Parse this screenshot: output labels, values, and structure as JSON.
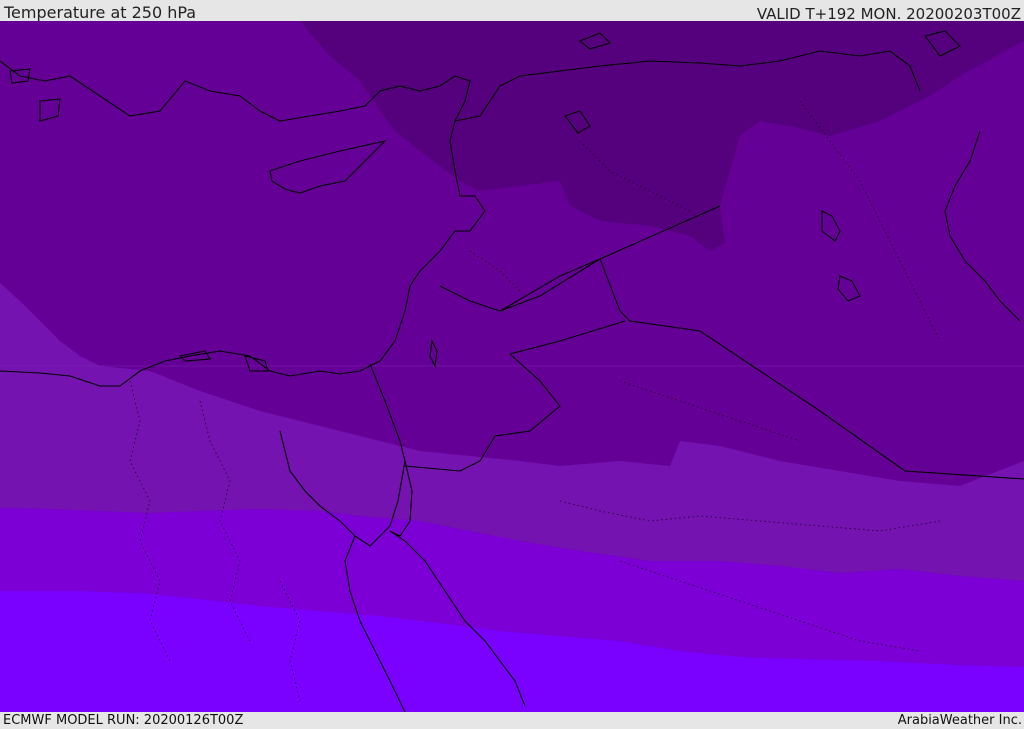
{
  "header": {
    "title": "Temperature at 250 hPa",
    "valid": "VALID T+192 MON. 20200203T00Z"
  },
  "footer": {
    "model_run": "ECMWF MODEL RUN: 20200126T00Z",
    "brand": "ArabiaWeather Inc."
  },
  "map": {
    "fill_colors": {
      "coldest_band": "#55007d",
      "cold_band": "#650096",
      "mid_band": "#7413b0",
      "warm_band": "#7c00d6",
      "warmest_band": "#7a00ff"
    },
    "coastline_color": "#000000"
  }
}
